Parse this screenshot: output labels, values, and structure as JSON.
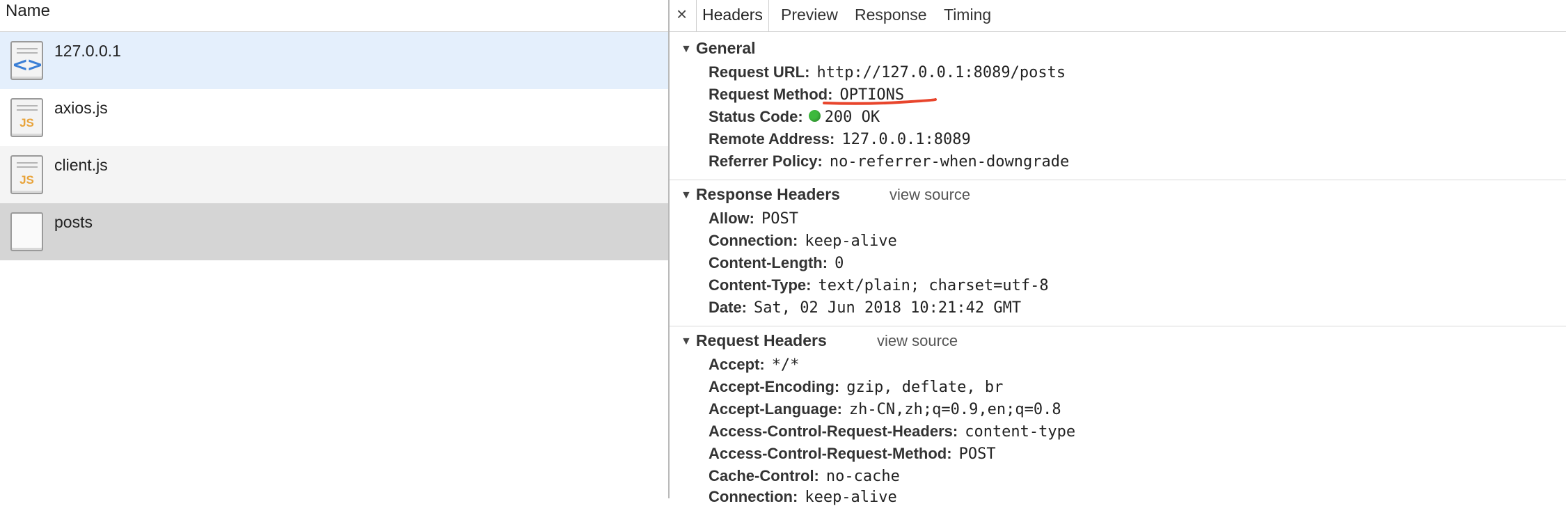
{
  "left": {
    "header": "Name",
    "rows": [
      {
        "label": "127.0.0.1",
        "icon": "document-icon",
        "bg": "#e4effc"
      },
      {
        "label": "axios.js",
        "icon": "script-icon",
        "bg": "#ffffff"
      },
      {
        "label": "client.js",
        "icon": "script-icon",
        "bg": "#f4f4f4"
      },
      {
        "label": "posts",
        "icon": "blank-file-icon",
        "bg": "#d5d5d5"
      }
    ],
    "glyphs": {
      "code": "<>",
      "js": "JS"
    }
  },
  "right": {
    "close": "×",
    "tabs": [
      "Headers",
      "Preview",
      "Response",
      "Timing"
    ],
    "view_source": "view source",
    "general": {
      "title": "General",
      "items": [
        {
          "k": "Request URL:",
          "v": "http://127.0.0.1:8089/posts"
        },
        {
          "k": "Request Method:",
          "v": "OPTIONS"
        },
        {
          "k": "Status Code:",
          "v": "200 OK"
        },
        {
          "k": "Remote Address:",
          "v": "127.0.0.1:8089"
        },
        {
          "k": "Referrer Policy:",
          "v": "no-referrer-when-downgrade"
        }
      ]
    },
    "response_headers": {
      "title": "Response Headers",
      "items": [
        {
          "k": "Allow:",
          "v": "POST"
        },
        {
          "k": "Connection:",
          "v": "keep-alive"
        },
        {
          "k": "Content-Length:",
          "v": "0"
        },
        {
          "k": "Content-Type:",
          "v": "text/plain; charset=utf-8"
        },
        {
          "k": "Date:",
          "v": "Sat, 02 Jun 2018 10:21:42 GMT"
        }
      ]
    },
    "request_headers": {
      "title": "Request Headers",
      "items": [
        {
          "k": "Accept:",
          "v": "*/*"
        },
        {
          "k": "Accept-Encoding:",
          "v": "gzip, deflate, br"
        },
        {
          "k": "Accept-Language:",
          "v": "zh-CN,zh;q=0.9,en;q=0.8"
        },
        {
          "k": "Access-Control-Request-Headers:",
          "v": "content-type"
        },
        {
          "k": "Access-Control-Request-Method:",
          "v": "POST"
        },
        {
          "k": "Cache-Control:",
          "v": "no-cache"
        },
        {
          "k": "Connection:",
          "v": "keep-alive"
        }
      ]
    },
    "annotation_color": "#e8452c",
    "status_color": "#3db93d"
  }
}
